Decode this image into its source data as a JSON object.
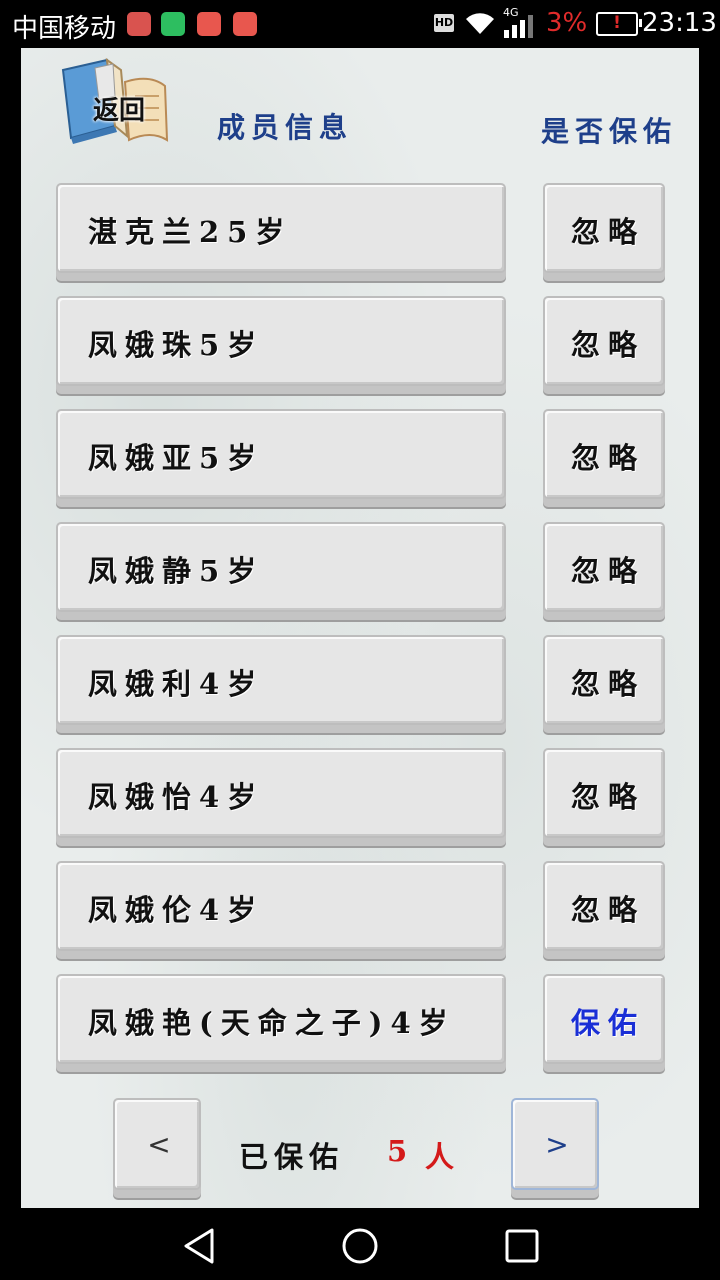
{
  "status_bar": {
    "carrier": "中国移动",
    "hd_badge": "HD",
    "network": "4G",
    "battery_percent": "3%",
    "battery_alert": "!",
    "time": "23:13"
  },
  "back_button": {
    "label": "返回"
  },
  "header": {
    "member_info": "成员信息",
    "protect_status": "是否保佑"
  },
  "members": [
    {
      "info": "湛克兰25岁",
      "action": "忽略",
      "protected": false
    },
    {
      "info": "凤娥珠5岁",
      "action": "忽略",
      "protected": false
    },
    {
      "info": "凤娥亚5岁",
      "action": "忽略",
      "protected": false
    },
    {
      "info": "凤娥静5岁",
      "action": "忽略",
      "protected": false
    },
    {
      "info": "凤娥利4岁",
      "action": "忽略",
      "protected": false
    },
    {
      "info": "凤娥怡4岁",
      "action": "忽略",
      "protected": false
    },
    {
      "info": "凤娥伦4岁",
      "action": "忽略",
      "protected": false
    },
    {
      "info": "凤娥艳(天命之子)4岁",
      "action": "保佑",
      "protected": true
    }
  ],
  "pager": {
    "prev_label": "<",
    "next_label": ">",
    "protected_label": "已保佑",
    "protected_count": "5",
    "protected_unit": "人"
  },
  "colors": {
    "header_blue": "#1e3f8a",
    "protect_blue": "#1a2fd6",
    "count_red": "#d41a1a",
    "battery_red": "#e02b2b"
  }
}
